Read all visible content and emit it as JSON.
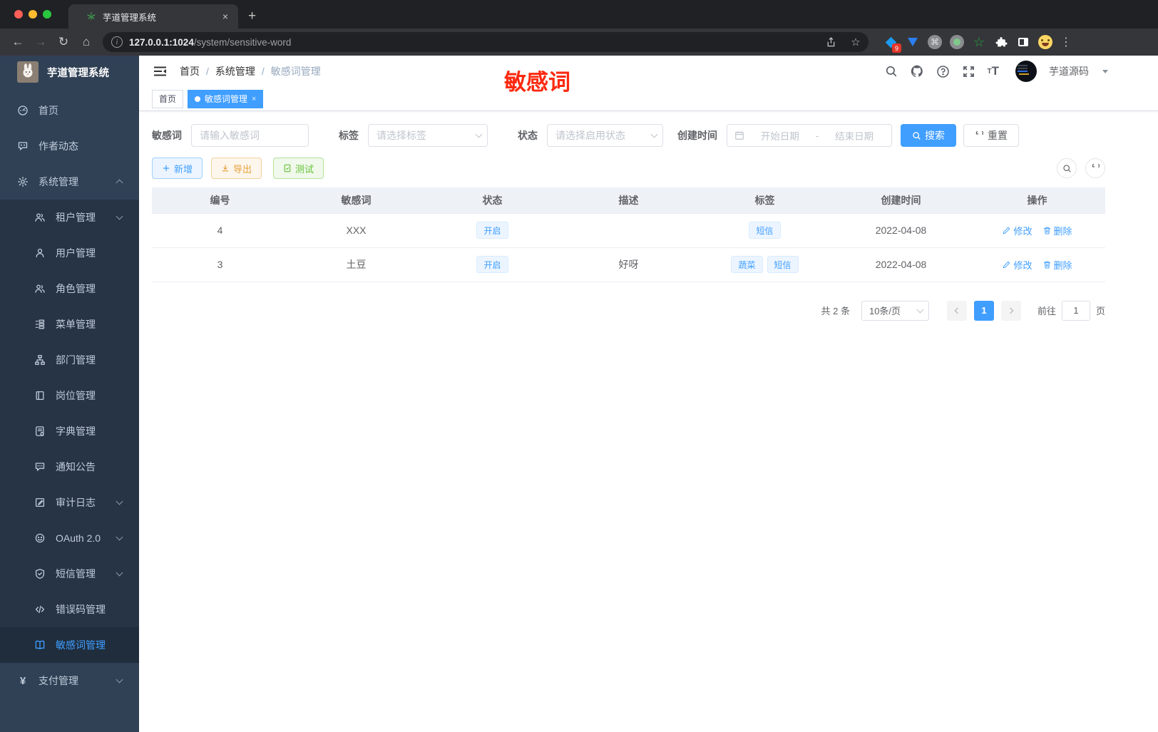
{
  "browser": {
    "tab": {
      "title": "芋道管理系统",
      "close": "×",
      "new_tab": "+"
    },
    "nav": {
      "back": "←",
      "forward": "→",
      "reload": "↻",
      "home": "⌂"
    },
    "url": {
      "host": "127.0.0.1:1024",
      "path": "/system/sensitive-word"
    },
    "pill_icons": {
      "star": "☆"
    },
    "extensions": {
      "badge": "9",
      "cmd": "⌘",
      "menu": "⋮"
    }
  },
  "sidebar": {
    "title": "芋道管理系统",
    "items": [
      {
        "label": "首页",
        "icon": "dashboard-icon",
        "level": "top"
      },
      {
        "label": "作者动态",
        "icon": "author-chat-icon",
        "level": "top"
      },
      {
        "label": "系统管理",
        "icon": "gear-icon",
        "level": "top",
        "arrow": "up"
      },
      {
        "label": "租户管理",
        "icon": "users-icon",
        "level": "sub",
        "arrow": "down"
      },
      {
        "label": "用户管理",
        "icon": "user-icon",
        "level": "sub"
      },
      {
        "label": "角色管理",
        "icon": "users-icon",
        "level": "sub"
      },
      {
        "label": "菜单管理",
        "icon": "menu-tree-icon",
        "level": "sub"
      },
      {
        "label": "部门管理",
        "icon": "org-chart-icon",
        "level": "sub"
      },
      {
        "label": "岗位管理",
        "icon": "badge-icon",
        "level": "sub"
      },
      {
        "label": "字典管理",
        "icon": "dictionary-icon",
        "level": "sub"
      },
      {
        "label": "通知公告",
        "icon": "notice-icon",
        "level": "sub"
      },
      {
        "label": "审计日志",
        "icon": "audit-log-icon",
        "level": "sub",
        "arrow": "down"
      },
      {
        "label": "OAuth 2.0",
        "icon": "oauth-icon",
        "level": "sub",
        "arrow": "down"
      },
      {
        "label": "短信管理",
        "icon": "shield-check-icon",
        "level": "sub",
        "arrow": "down"
      },
      {
        "label": "错误码管理",
        "icon": "code-icon",
        "level": "sub"
      },
      {
        "label": "敏感词管理",
        "icon": "open-book-icon",
        "level": "sub",
        "active": true
      },
      {
        "label": "支付管理",
        "icon": "yen-icon",
        "level": "top",
        "arrow": "down"
      }
    ]
  },
  "navbar": {
    "breadcrumb": [
      "首页",
      "系统管理",
      "敏感词管理"
    ],
    "separator": "/",
    "username": "芋道源码"
  },
  "tags_view": [
    {
      "label": "首页",
      "active": false
    },
    {
      "label": "敏感词管理",
      "active": true,
      "close": "×"
    }
  ],
  "annotation": {
    "text": "敏感词",
    "color": "#fb2a10"
  },
  "filters": {
    "word": {
      "label": "敏感词",
      "placeholder": "请输入敏感词"
    },
    "tag": {
      "label": "标签",
      "placeholder": "请选择标签"
    },
    "status": {
      "label": "状态",
      "placeholder": "请选择启用状态"
    },
    "date": {
      "label": "创建时间",
      "start_placeholder": "开始日期",
      "separator": "-",
      "end_placeholder": "结束日期"
    },
    "search_label": "搜索",
    "reset_label": "重置"
  },
  "actions": {
    "add": "新增",
    "export": "导出",
    "test": "测试"
  },
  "table": {
    "columns": [
      "编号",
      "敏感词",
      "状态",
      "描述",
      "标签",
      "创建时间",
      "操作"
    ],
    "rows": [
      {
        "id": "4",
        "word": "XXX",
        "status": "开启",
        "description": "",
        "tags": [
          "短信"
        ],
        "created": "2022-04-08"
      },
      {
        "id": "3",
        "word": "土豆",
        "status": "开启",
        "description": "好呀",
        "tags": [
          "蔬菜",
          "短信"
        ],
        "created": "2022-04-08"
      }
    ],
    "edit_label": "修改",
    "delete_label": "删除"
  },
  "pagination": {
    "total": "共 2 条",
    "page_size": "10条/页",
    "current": "1",
    "goto_label": "前往",
    "goto_value": "1",
    "unit_label": "页"
  },
  "colors": {
    "accent": "#409eff",
    "annotation_red": "#fb2a10",
    "sidebar_bg": "#304156",
    "submenu_bg": "#263445"
  }
}
